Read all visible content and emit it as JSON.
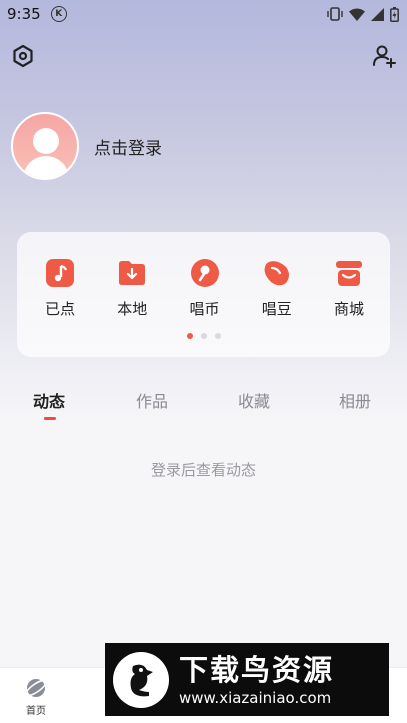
{
  "status_bar": {
    "time": "9:35",
    "k_badge": "K",
    "icons": [
      "vibrate-icon",
      "wifi-icon",
      "signal-icon",
      "battery-icon"
    ]
  },
  "header": {
    "settings_icon": "settings-hexagon-icon",
    "add_user_icon": "add-user-icon"
  },
  "profile": {
    "login_prompt": "点击登录"
  },
  "quick_actions": {
    "items": [
      {
        "label": "已点",
        "icon": "music-note-icon"
      },
      {
        "label": "本地",
        "icon": "download-folder-icon"
      },
      {
        "label": "唱币",
        "icon": "coin-icon"
      },
      {
        "label": "唱豆",
        "icon": "bean-icon"
      },
      {
        "label": "商城",
        "icon": "shop-icon"
      }
    ],
    "page_count": 3,
    "active_page": 1,
    "accent_color": "#ef5a4a"
  },
  "tabs": {
    "items": [
      {
        "label": "动态",
        "active": true
      },
      {
        "label": "作品",
        "active": false
      },
      {
        "label": "收藏",
        "active": false
      },
      {
        "label": "相册",
        "active": false
      }
    ]
  },
  "feed": {
    "empty_message": "登录后查看动态"
  },
  "bottom_nav": {
    "items": [
      {
        "label": "首页",
        "icon": "planet-icon"
      }
    ]
  },
  "watermark": {
    "title": "下载鸟资源",
    "url": "www.xiazainiao.com"
  }
}
